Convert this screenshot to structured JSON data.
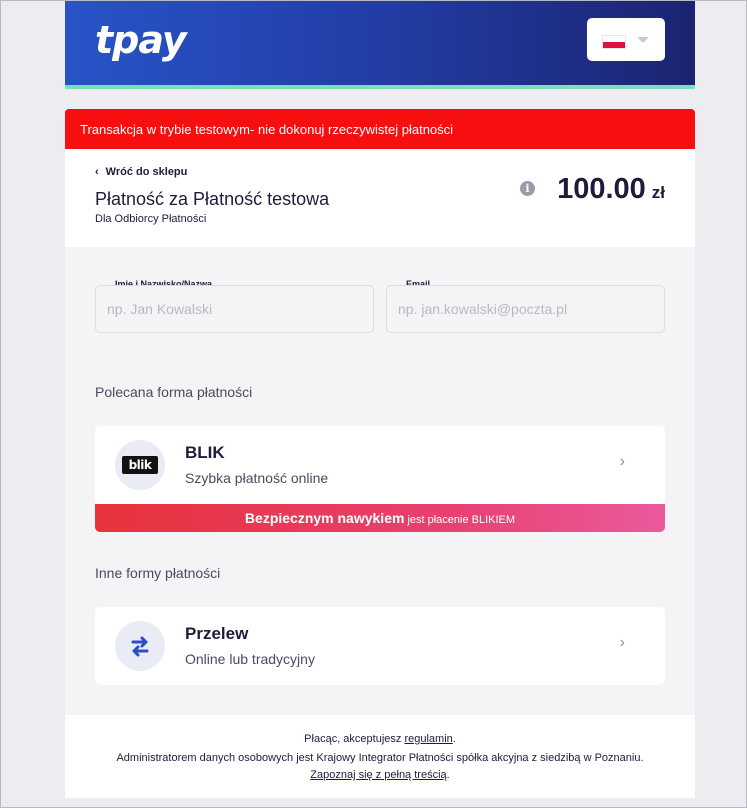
{
  "header": {
    "logo": "tpay",
    "language_flag": "flag-pl-icon"
  },
  "test_banner": "Transakcja w trybie testowym- nie dokonuj rzeczywistej płatności",
  "summary": {
    "back_label": "Wróć do sklepu",
    "title": "Płatność za Płatność testowa",
    "recipient": "Dla Odbiorcy Płatności",
    "amount": "100.00",
    "currency": "zł"
  },
  "form": {
    "name_label": "Imię i Nazwisko/Nazwa",
    "name_placeholder": "np. Jan Kowalski",
    "email_label": "Email",
    "email_placeholder": "np. jan.kowalski@poczta.pl"
  },
  "recommended": {
    "title": "Polecana forma płatności",
    "method": {
      "name": "BLIK",
      "description": "Szybka płatność online",
      "logo_text": "blik"
    },
    "banner_strong": "Bezpiecznym nawykiem",
    "banner_rest": "jest płacenie BLIKIEM"
  },
  "other": {
    "title": "Inne formy płatności",
    "method": {
      "name": "Przelew",
      "description": "Online lub tradycyjny"
    }
  },
  "footer": {
    "line1_prefix": "Płacąc, akceptujesz ",
    "line1_link": "regulamin",
    "line1_suffix": ".",
    "line2": "Administratorem danych osobowych jest Krajowy Integrator Płatności spółka akcyjna z siedzibą w Poznaniu.",
    "line3_link": "Zapoznaj się z pełną treścią",
    "line3_suffix": "."
  },
  "colors": {
    "test_banner": "#f70e0e",
    "header_start": "#2954c8",
    "header_end": "#1c2470",
    "header_border": "#7be0b9",
    "blik_banner_start": "#e8333a",
    "blik_banner_end": "#ea5a9c",
    "transfer_icon": "#2b4fc0"
  }
}
